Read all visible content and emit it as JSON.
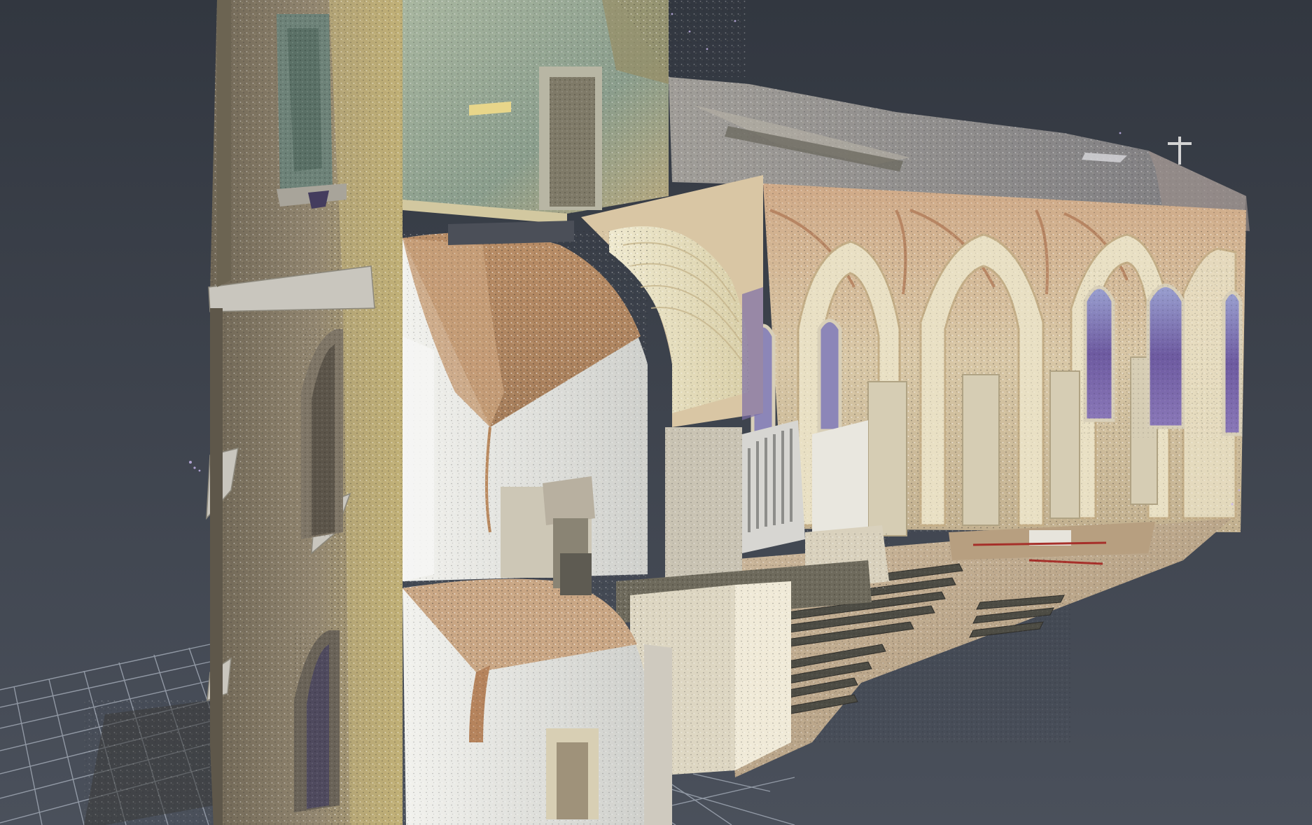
{
  "viewer": {
    "background_top": "#323740",
    "background_bottom": "#4a505b",
    "grid_color": "#aab2be"
  },
  "scene": {
    "model_icon": "point-cloud-model-icon",
    "palette": {
      "tower_stone": "#8c806a",
      "tower_highlight": "#c8b878",
      "belfry_green": "#8fa590",
      "roof_grey": "#8e8e92",
      "vault_ochre": "#b58a63",
      "wall_white": "#e4e2da",
      "arch_cream": "#e6ddb8",
      "nave_beige": "#cdb99a",
      "window_violet": "#7a6aa8",
      "floor_tan": "#c8b498",
      "pew_dark": "#4a4a42"
    }
  }
}
